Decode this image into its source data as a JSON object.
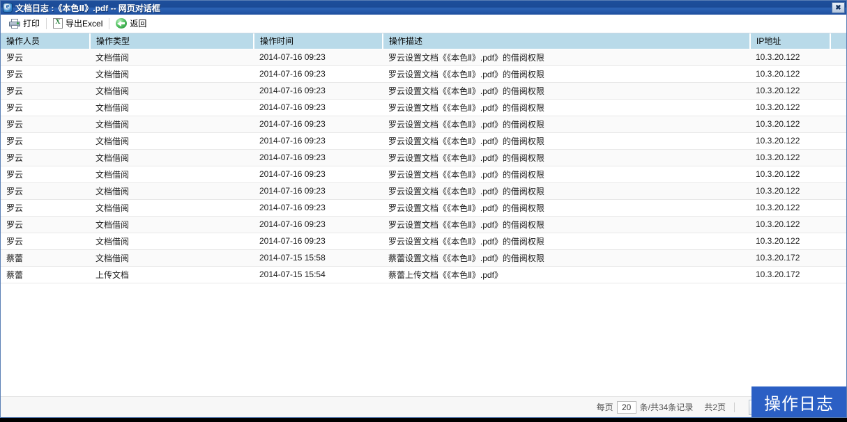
{
  "window": {
    "title": "文档日志 :《本色Ⅱ》.pdf -- 网页对话框",
    "icon": "ie-browser-icon",
    "close_label": "✖"
  },
  "toolbar": {
    "print_label": "打印",
    "export_label": "导出Excel",
    "back_label": "返回",
    "print_icon": "printer-icon",
    "export_icon": "excel-icon",
    "back_icon": "green-back-arrow-icon"
  },
  "table": {
    "columns": [
      {
        "key": "user",
        "label": "操作人员"
      },
      {
        "key": "type",
        "label": "操作类型"
      },
      {
        "key": "time",
        "label": "操作时间"
      },
      {
        "key": "desc",
        "label": "操作描述"
      },
      {
        "key": "ip",
        "label": "IP地址"
      },
      {
        "key": "tail",
        "label": ""
      }
    ],
    "rows": [
      {
        "user": "罗云",
        "type": "文档借阅",
        "time": "2014-07-16 09:23",
        "desc": "罗云设置文档《《本色Ⅱ》.pdf》的借阅权限",
        "ip": "10.3.20.122"
      },
      {
        "user": "罗云",
        "type": "文档借阅",
        "time": "2014-07-16 09:23",
        "desc": "罗云设置文档《《本色Ⅱ》.pdf》的借阅权限",
        "ip": "10.3.20.122"
      },
      {
        "user": "罗云",
        "type": "文档借阅",
        "time": "2014-07-16 09:23",
        "desc": "罗云设置文档《《本色Ⅱ》.pdf》的借阅权限",
        "ip": "10.3.20.122"
      },
      {
        "user": "罗云",
        "type": "文档借阅",
        "time": "2014-07-16 09:23",
        "desc": "罗云设置文档《《本色Ⅱ》.pdf》的借阅权限",
        "ip": "10.3.20.122"
      },
      {
        "user": "罗云",
        "type": "文档借阅",
        "time": "2014-07-16 09:23",
        "desc": "罗云设置文档《《本色Ⅱ》.pdf》的借阅权限",
        "ip": "10.3.20.122"
      },
      {
        "user": "罗云",
        "type": "文档借阅",
        "time": "2014-07-16 09:23",
        "desc": "罗云设置文档《《本色Ⅱ》.pdf》的借阅权限",
        "ip": "10.3.20.122"
      },
      {
        "user": "罗云",
        "type": "文档借阅",
        "time": "2014-07-16 09:23",
        "desc": "罗云设置文档《《本色Ⅱ》.pdf》的借阅权限",
        "ip": "10.3.20.122"
      },
      {
        "user": "罗云",
        "type": "文档借阅",
        "time": "2014-07-16 09:23",
        "desc": "罗云设置文档《《本色Ⅱ》.pdf》的借阅权限",
        "ip": "10.3.20.122"
      },
      {
        "user": "罗云",
        "type": "文档借阅",
        "time": "2014-07-16 09:23",
        "desc": "罗云设置文档《《本色Ⅱ》.pdf》的借阅权限",
        "ip": "10.3.20.122"
      },
      {
        "user": "罗云",
        "type": "文档借阅",
        "time": "2014-07-16 09:23",
        "desc": "罗云设置文档《《本色Ⅱ》.pdf》的借阅权限",
        "ip": "10.3.20.122"
      },
      {
        "user": "罗云",
        "type": "文档借阅",
        "time": "2014-07-16 09:23",
        "desc": "罗云设置文档《《本色Ⅱ》.pdf》的借阅权限",
        "ip": "10.3.20.122"
      },
      {
        "user": "罗云",
        "type": "文档借阅",
        "time": "2014-07-16 09:23",
        "desc": "罗云设置文档《《本色Ⅱ》.pdf》的借阅权限",
        "ip": "10.3.20.122"
      },
      {
        "user": "蔡蕾",
        "type": "文档借阅",
        "time": "2014-07-15 15:58",
        "desc": "蔡蕾设置文档《《本色Ⅱ》.pdf》的借阅权限",
        "ip": "10.3.20.172"
      },
      {
        "user": "蔡蕾",
        "type": "上传文档",
        "time": "2014-07-15 15:54",
        "desc": "蔡蕾上传文档《《本色Ⅱ》.pdf》",
        "ip": "10.3.20.172"
      }
    ]
  },
  "pagination": {
    "per_page_prefix": "每页",
    "per_page_value": "20",
    "records_text": "条/共34条记录",
    "pages_text": "共2页",
    "first_label": "|◀",
    "prev_label": "‹",
    "next_label": "›",
    "last_label": "▶|",
    "first_icon": "first-page-icon",
    "prev_icon": "prev-page-icon",
    "next_icon": "next-page-icon",
    "last_icon": "last-page-icon"
  },
  "badge": {
    "text": "操作日志",
    "color": "#2b5fc4"
  }
}
